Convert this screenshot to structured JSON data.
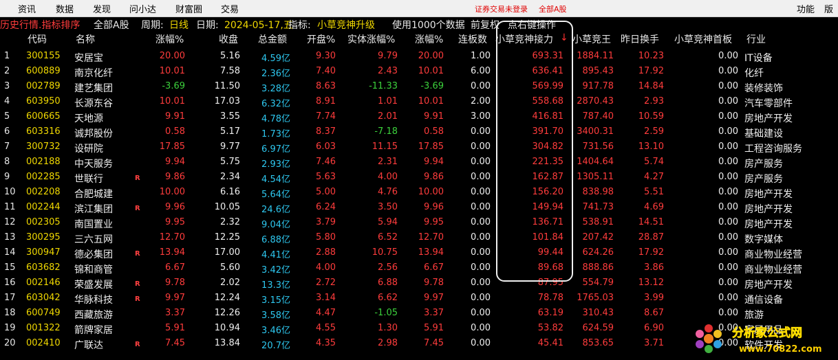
{
  "menu": {
    "items": [
      "资讯",
      "数据",
      "发现",
      "问小达",
      "财富圈",
      "交易"
    ],
    "login_notice": "证券交易未登录",
    "market": "全部A股",
    "right": [
      "功能",
      "版"
    ]
  },
  "infobar": {
    "mode": "历史行情.指标排序",
    "market": "全部A股",
    "period_label": "周期:",
    "period": "日线",
    "date_label": "日期:",
    "date": "2024-05-17,五",
    "indicator_label": "指标:",
    "indicator": "小草竞神升级",
    "use_data": "使用1000个数据",
    "adjust": "前复权",
    "hint": "点右键操作"
  },
  "headers": [
    "代码",
    "名称",
    "涨幅%",
    "收盘",
    "总金额",
    "开盘%",
    "实体涨幅%",
    "涨幅%",
    "连板数",
    "小草竞神接力",
    "小草竞王",
    "昨日换手",
    "小草竞神首板",
    "行业"
  ],
  "sort_arrow": "↓",
  "rows": [
    {
      "idx": "1",
      "code": "300155",
      "name": "安居宝",
      "flag": "",
      "chg": "20.00",
      "close": "5.16",
      "amt": "4.59亿",
      "open": "9.30",
      "body": "9.79",
      "chg2": "20.00",
      "boards": "1.00",
      "relay": "693.31",
      "king": "1884.11",
      "turn": "10.23",
      "first": "0.00",
      "ind": "IT设备"
    },
    {
      "idx": "2",
      "code": "600889",
      "name": "南京化纤",
      "flag": "",
      "chg": "10.01",
      "close": "7.58",
      "amt": "2.36亿",
      "open": "7.40",
      "body": "2.43",
      "chg2": "10.01",
      "boards": "6.00",
      "relay": "636.41",
      "king": "895.43",
      "turn": "17.92",
      "first": "0.00",
      "ind": "化纤"
    },
    {
      "idx": "3",
      "code": "002789",
      "name": "建艺集团",
      "flag": "",
      "chg": "-3.69",
      "close": "11.50",
      "amt": "3.28亿",
      "open": "8.63",
      "body": "-11.33",
      "chg2": "-3.69",
      "boards": "0.00",
      "relay": "569.99",
      "king": "917.78",
      "turn": "14.84",
      "first": "0.00",
      "ind": "装修装饰"
    },
    {
      "idx": "4",
      "code": "603950",
      "name": "长源东谷",
      "flag": "",
      "chg": "10.01",
      "close": "17.03",
      "amt": "6.32亿",
      "open": "8.91",
      "body": "1.01",
      "chg2": "10.01",
      "boards": "2.00",
      "relay": "558.68",
      "king": "2870.43",
      "turn": "2.93",
      "first": "0.00",
      "ind": "汽车零部件"
    },
    {
      "idx": "5",
      "code": "600665",
      "name": "天地源",
      "flag": "",
      "chg": "9.91",
      "close": "3.55",
      "amt": "4.78亿",
      "open": "7.74",
      "body": "2.01",
      "chg2": "9.91",
      "boards": "3.00",
      "relay": "416.81",
      "king": "787.40",
      "turn": "10.59",
      "first": "0.00",
      "ind": "房地产开发"
    },
    {
      "idx": "6",
      "code": "603316",
      "name": "诚邦股份",
      "flag": "",
      "chg": "0.58",
      "close": "5.17",
      "amt": "1.73亿",
      "open": "8.37",
      "body": "-7.18",
      "chg2": "0.58",
      "boards": "0.00",
      "relay": "391.70",
      "king": "3400.31",
      "turn": "2.59",
      "first": "0.00",
      "ind": "基础建设"
    },
    {
      "idx": "7",
      "code": "300732",
      "name": "设研院",
      "flag": "",
      "chg": "17.85",
      "close": "9.77",
      "amt": "6.97亿",
      "open": "6.03",
      "body": "11.15",
      "chg2": "17.85",
      "boards": "0.00",
      "relay": "304.82",
      "king": "731.56",
      "turn": "13.10",
      "first": "0.00",
      "ind": "工程咨询服务"
    },
    {
      "idx": "8",
      "code": "002188",
      "name": "中天服务",
      "flag": "",
      "chg": "9.94",
      "close": "5.75",
      "amt": "2.93亿",
      "open": "7.46",
      "body": "2.31",
      "chg2": "9.94",
      "boards": "0.00",
      "relay": "221.35",
      "king": "1404.64",
      "turn": "5.74",
      "first": "0.00",
      "ind": "房产服务"
    },
    {
      "idx": "9",
      "code": "002285",
      "name": "世联行",
      "flag": "R",
      "chg": "9.86",
      "close": "2.34",
      "amt": "4.54亿",
      "open": "5.63",
      "body": "4.00",
      "chg2": "9.86",
      "boards": "0.00",
      "relay": "162.87",
      "king": "1305.11",
      "turn": "4.27",
      "first": "0.00",
      "ind": "房产服务"
    },
    {
      "idx": "10",
      "code": "002208",
      "name": "合肥城建",
      "flag": "",
      "chg": "10.00",
      "close": "6.16",
      "amt": "5.64亿",
      "open": "5.00",
      "body": "4.76",
      "chg2": "10.00",
      "boards": "0.00",
      "relay": "156.20",
      "king": "838.98",
      "turn": "5.51",
      "first": "0.00",
      "ind": "房地产开发"
    },
    {
      "idx": "11",
      "code": "002244",
      "name": "滨江集团",
      "flag": "R",
      "chg": "9.96",
      "close": "10.05",
      "amt": "24.6亿",
      "open": "6.24",
      "body": "3.50",
      "chg2": "9.96",
      "boards": "0.00",
      "relay": "149.94",
      "king": "741.73",
      "turn": "4.69",
      "first": "0.00",
      "ind": "房地产开发"
    },
    {
      "idx": "12",
      "code": "002305",
      "name": "南国置业",
      "flag": "",
      "chg": "9.95",
      "close": "2.32",
      "amt": "9.04亿",
      "open": "3.79",
      "body": "5.94",
      "chg2": "9.95",
      "boards": "0.00",
      "relay": "136.71",
      "king": "538.91",
      "turn": "14.51",
      "first": "0.00",
      "ind": "房地产开发"
    },
    {
      "idx": "13",
      "code": "300295",
      "name": "三六五网",
      "flag": "",
      "chg": "12.70",
      "close": "12.25",
      "amt": "6.88亿",
      "open": "5.80",
      "body": "6.52",
      "chg2": "12.70",
      "boards": "0.00",
      "relay": "101.84",
      "king": "207.42",
      "turn": "28.87",
      "first": "0.00",
      "ind": "数字媒体"
    },
    {
      "idx": "14",
      "code": "300947",
      "name": "德必集团",
      "flag": "R",
      "chg": "13.94",
      "close": "17.00",
      "amt": "4.41亿",
      "open": "2.88",
      "body": "10.75",
      "chg2": "13.94",
      "boards": "0.00",
      "relay": "99.44",
      "king": "624.26",
      "turn": "17.92",
      "first": "0.00",
      "ind": "商业物业经营"
    },
    {
      "idx": "15",
      "code": "603682",
      "name": "锦和商管",
      "flag": "",
      "chg": "6.67",
      "close": "5.60",
      "amt": "3.42亿",
      "open": "4.00",
      "body": "2.56",
      "chg2": "6.67",
      "boards": "0.00",
      "relay": "89.68",
      "king": "888.86",
      "turn": "3.86",
      "first": "0.00",
      "ind": "商业物业经营"
    },
    {
      "idx": "16",
      "code": "002146",
      "name": "荣盛发展",
      "flag": "R",
      "chg": "9.78",
      "close": "2.02",
      "amt": "13.3亿",
      "open": "2.72",
      "body": "6.88",
      "chg2": "9.78",
      "boards": "0.00",
      "relay": "87.95",
      "king": "554.79",
      "turn": "13.12",
      "first": "0.00",
      "ind": "房地产开发"
    },
    {
      "idx": "17",
      "code": "603042",
      "name": "华脉科技",
      "flag": "R",
      "chg": "9.97",
      "close": "12.24",
      "amt": "3.15亿",
      "open": "3.14",
      "body": "6.62",
      "chg2": "9.97",
      "boards": "0.00",
      "relay": "78.78",
      "king": "1765.03",
      "turn": "3.99",
      "first": "0.00",
      "ind": "通信设备"
    },
    {
      "idx": "18",
      "code": "600749",
      "name": "西藏旅游",
      "flag": "",
      "chg": "3.37",
      "close": "12.26",
      "amt": "3.58亿",
      "open": "4.47",
      "body": "-1.05",
      "chg2": "3.37",
      "boards": "0.00",
      "relay": "63.19",
      "king": "310.43",
      "turn": "8.67",
      "first": "0.00",
      "ind": "旅游"
    },
    {
      "idx": "19",
      "code": "001322",
      "name": "箭牌家居",
      "flag": "",
      "chg": "5.91",
      "close": "10.94",
      "amt": "3.46亿",
      "open": "4.55",
      "body": "1.30",
      "chg2": "5.91",
      "boards": "0.00",
      "relay": "53.82",
      "king": "624.59",
      "turn": "6.90",
      "first": "0.00",
      "ind": "家居用品"
    },
    {
      "idx": "20",
      "code": "002410",
      "name": "广联达",
      "flag": "R",
      "chg": "7.45",
      "close": "13.84",
      "amt": "20.7亿",
      "open": "4.35",
      "body": "2.98",
      "chg2": "7.45",
      "boards": "0.00",
      "relay": "45.41",
      "king": "853.65",
      "turn": "3.71",
      "first": "0.00",
      "ind": "软件开发"
    }
  ],
  "watermark": {
    "brand": "分析家公式网",
    "url": "www.70822.com"
  },
  "colors": {
    "background": "#000000",
    "up": "#ff3c3c",
    "down": "#3cd23c",
    "code": "#f0d800",
    "amount": "#2ec8f0"
  }
}
